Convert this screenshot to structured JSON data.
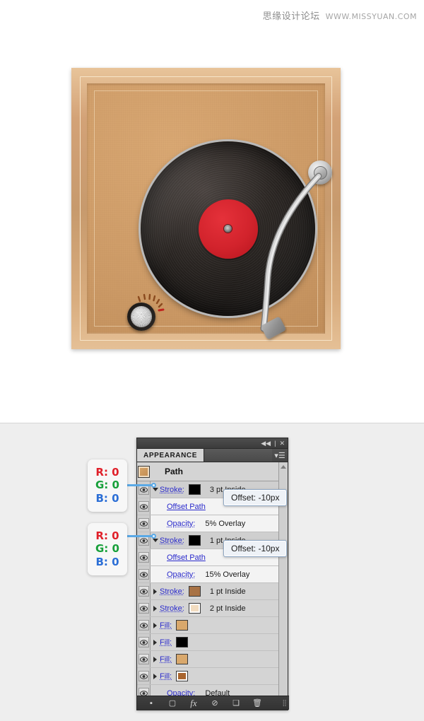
{
  "watermark": {
    "site_cn": "思缘设计论坛",
    "url": "WWW.MISSYUAN.COM"
  },
  "illustration": {
    "name": "turntable-record-player-icon",
    "frame_color": "#d3a277",
    "board_color": "#cc9a66",
    "record_color": "#1a1715",
    "label_color": "#d2232c",
    "tonearm_color": "#b3b3b3",
    "knob_color": "#cacaca"
  },
  "panel": {
    "title": "APPEARANCE",
    "titlebar": {
      "collapse_icon": "◀◀",
      "separator": "|",
      "close_icon": "✕"
    },
    "menu_icon": "▾☰",
    "target": {
      "label": "Path",
      "thumb_color": "#d9a86c"
    },
    "rows": [
      {
        "id": "stroke-3pt",
        "type": "stroke",
        "label": "Stroke:",
        "swatch": "#000000",
        "value": "3 pt  Inside",
        "disclosure": "open",
        "band": "alt"
      },
      {
        "id": "offset-path-1",
        "type": "effect",
        "label": "Offset Path",
        "swatch": null,
        "value": "",
        "disclosure": "none",
        "band": "white"
      },
      {
        "id": "opacity-5",
        "type": "opacity",
        "label": "Opacity:",
        "swatch": null,
        "value": "5% Overlay",
        "disclosure": "none",
        "band": "white"
      },
      {
        "id": "stroke-1pt-black",
        "type": "stroke",
        "label": "Stroke:",
        "swatch": "#000000",
        "value": "1 pt  Inside",
        "disclosure": "open",
        "band": "alt"
      },
      {
        "id": "offset-path-2",
        "type": "effect",
        "label": "Offset Path",
        "swatch": null,
        "value": "",
        "disclosure": "none",
        "band": "white"
      },
      {
        "id": "opacity-15",
        "type": "opacity",
        "label": "Opacity:",
        "swatch": null,
        "value": "15% Overlay",
        "disclosure": "none",
        "band": "white"
      },
      {
        "id": "stroke-1pt-brown",
        "type": "stroke",
        "label": "Stroke:",
        "swatch": "#a87244",
        "value": "1 pt  Inside",
        "disclosure": "closed",
        "band": "plain"
      },
      {
        "id": "stroke-2pt-cream",
        "type": "stroke",
        "label": "Stroke:",
        "swatch": "#f2dcc0",
        "value": "2 pt  Inside",
        "disclosure": "closed",
        "band": "plain"
      },
      {
        "id": "fill-tan-1",
        "type": "fill",
        "label": "Fill:",
        "swatch": "#d9a86c",
        "value": "",
        "disclosure": "closed",
        "band": "plain"
      },
      {
        "id": "fill-black",
        "type": "fill",
        "label": "Fill:",
        "swatch": "#000000",
        "value": "",
        "disclosure": "closed",
        "band": "plain"
      },
      {
        "id": "fill-tan-2",
        "type": "fill",
        "label": "Fill:",
        "swatch": "#d9a86c",
        "value": "",
        "disclosure": "closed",
        "band": "plain"
      },
      {
        "id": "fill-brown",
        "type": "fill",
        "label": "Fill:",
        "swatch": "#a9652f",
        "value": "",
        "disclosure": "closed",
        "band": "plain"
      },
      {
        "id": "opacity-default",
        "type": "opacity",
        "label": "Opacity:",
        "swatch": null,
        "value": "Default",
        "disclosure": "none",
        "band": "plain"
      }
    ],
    "footer_buttons": [
      {
        "id": "add-new-stroke",
        "glyph": "▪"
      },
      {
        "id": "add-new-fill",
        "glyph": "▢"
      },
      {
        "id": "add-new-effect",
        "glyph": "fx"
      },
      {
        "id": "clear-appearance",
        "glyph": "⊘"
      },
      {
        "id": "duplicate-item",
        "glyph": "❏"
      },
      {
        "id": "delete-item",
        "glyph": "🗑"
      }
    ],
    "scrollbar": {
      "up_arrow": "▲",
      "down_arrow": "▼"
    }
  },
  "tooltips": [
    {
      "id": "offset-tooltip-1",
      "text": "Offset: -10px"
    },
    {
      "id": "offset-tooltip-2",
      "text": "Offset: -10px"
    }
  ],
  "callouts": [
    {
      "id": "rgb-callout-1",
      "r": "R: 0",
      "g": "G: 0",
      "b": "B: 0"
    },
    {
      "id": "rgb-callout-2",
      "r": "R: 0",
      "g": "G: 0",
      "b": "B: 0"
    }
  ],
  "colors": {
    "callout_red": "#e0202a",
    "callout_green": "#17a03a",
    "callout_blue": "#2c6fd6",
    "connector_blue": "#5aa9e6",
    "property_link": "#2b2bcc"
  }
}
